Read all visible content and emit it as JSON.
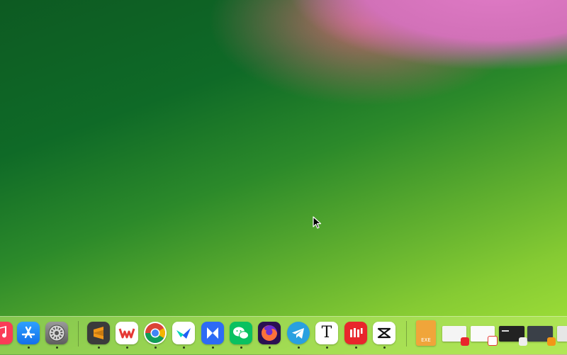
{
  "desktop": {
    "wallpaper": "green-wave-gradient"
  },
  "dock": {
    "background": "#bdeb6e",
    "apps": [
      {
        "name": "music-app-icon",
        "color": "#fa3c57",
        "running": false
      },
      {
        "name": "app-store-icon",
        "color": "#1c8ef5",
        "running": true
      },
      {
        "name": "system-settings-icon",
        "color": "#7a7a7a",
        "running": true
      },
      {
        "name": "sublime-text-icon",
        "color": "#f29717",
        "running": true
      },
      {
        "name": "wps-office-icon",
        "color": "#e53935",
        "running": true
      },
      {
        "name": "chrome-icon",
        "color": "#4285f4",
        "running": true
      },
      {
        "name": "lark-icon",
        "color": "#1f5ff5",
        "running": true
      },
      {
        "name": "xcode-like-icon",
        "color": "#2d6bf5",
        "running": true
      },
      {
        "name": "wechat-icon",
        "color": "#09c160",
        "running": true
      },
      {
        "name": "firefox-icon",
        "color": "#ff7139",
        "running": true
      },
      {
        "name": "telegram-icon",
        "color": "#29a0e0",
        "running": true
      },
      {
        "name": "typora-icon",
        "color": "#ffffff",
        "running": true,
        "glyph": "T"
      },
      {
        "name": "iqiyi-icon",
        "color": "#e8262c",
        "running": true
      },
      {
        "name": "capcut-icon",
        "color": "#ffffff",
        "running": true
      }
    ],
    "files": [
      {
        "name": "exe-file-icon",
        "label": "EXE",
        "color": "#f0a53a"
      }
    ],
    "windows": [
      {
        "name": "window-thumbnail-1",
        "badge_color": "#e8262c"
      },
      {
        "name": "window-thumbnail-2",
        "badge_color": "#e53935"
      },
      {
        "name": "window-thumbnail-3",
        "badge_color": "#555555"
      },
      {
        "name": "window-thumbnail-4",
        "badge_color": "#f29717"
      },
      {
        "name": "window-thumbnail-5",
        "badge_color": "#dddddd"
      }
    ]
  }
}
